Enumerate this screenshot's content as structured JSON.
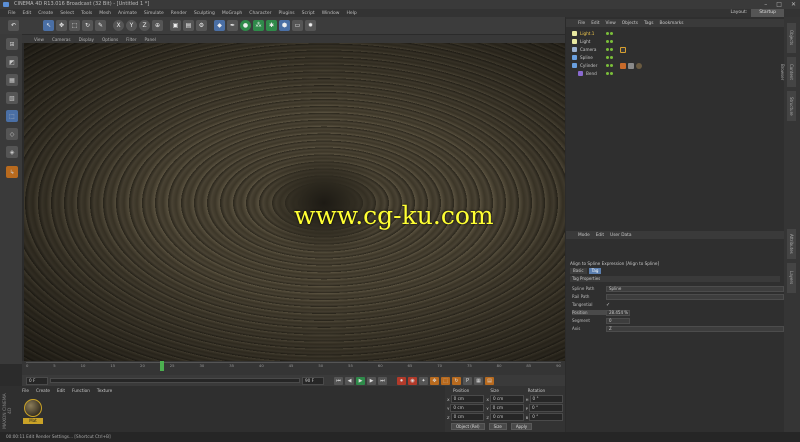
{
  "title": "CINEMA 4D R13.016 Broadcast (32 Bit) - [Untitled 1 *]",
  "window_buttons": [
    "–",
    "□",
    "✕"
  ],
  "menu": [
    "File",
    "Edit",
    "Create",
    "Select",
    "Tools",
    "Mesh",
    "Animate",
    "Simulate",
    "Render",
    "Sculpting",
    "MoGraph",
    "Character",
    "Plugins",
    "Script",
    "Window",
    "Help"
  ],
  "layout": {
    "label": "Layout:",
    "value": "Startup"
  },
  "toolbar_glyphs": {
    "undo": "↶",
    "x": "X",
    "y": "Y",
    "z": "Z"
  },
  "viewport": {
    "menu": [
      "View",
      "Cameras",
      "Display",
      "Options",
      "Filter",
      "Panel"
    ],
    "watermark": "www.cg-ku.com"
  },
  "timeline": {
    "ticks": [
      "0",
      "5",
      "10",
      "15",
      "20",
      "25",
      "30",
      "35",
      "40",
      "45",
      "50",
      "55",
      "60",
      "65",
      "70",
      "75",
      "80",
      "85",
      "90"
    ],
    "start_frame": "0 F",
    "end_frame": "90 F",
    "playhead_fraction": 0.25
  },
  "transport_glyphs": [
    "⏮",
    "◀",
    "▶",
    "▶",
    "⏭",
    "⏺"
  ],
  "material": {
    "menu": [
      "File",
      "Create",
      "Edit",
      "Function",
      "Texture"
    ],
    "maxon": "MAXON CINEMA 4D",
    "name": "Mat"
  },
  "coordinates": {
    "headers": [
      "Position",
      "Size",
      "Rotation"
    ],
    "rows": [
      {
        "axis": "X",
        "pos": "0 cm",
        "size_axis": "X",
        "size": "0 cm",
        "rot_axis": "H",
        "rot": "0 °"
      },
      {
        "axis": "Y",
        "pos": "0 cm",
        "size_axis": "Y",
        "size": "0 cm",
        "rot_axis": "P",
        "rot": "0 °"
      },
      {
        "axis": "Z",
        "pos": "0 cm",
        "size_axis": "Z",
        "size": "0 cm",
        "rot_axis": "B",
        "rot": "0 °"
      }
    ],
    "mode": "Object (Rel)",
    "size_mode": "Size",
    "apply": "Apply"
  },
  "statusbar": "00:00:11   Edit Render Settings... [Shortcut Ctrl+B]",
  "objects": {
    "menu": [
      "File",
      "Edit",
      "View",
      "Objects",
      "Tags",
      "Bookmarks"
    ],
    "items": [
      {
        "name": "Light.1",
        "color": "#e8e8a0"
      },
      {
        "name": "Light",
        "color": "#e8e8a0"
      },
      {
        "name": "Camera",
        "color": "#9ab0d0"
      },
      {
        "name": "Spline",
        "color": "#6aa0e0"
      },
      {
        "name": "Cylinder",
        "color": "#6aa0e0"
      },
      {
        "name": "Bend",
        "color": "#8a6ad0"
      }
    ]
  },
  "attributes": {
    "menu": [
      "Mode",
      "Edit",
      "User Data"
    ],
    "title": "Align to Spline Expression [Align to Spline]",
    "tabs": [
      "Basic",
      "Tag"
    ],
    "section": "Tag Properties",
    "rows": [
      {
        "label": "Spline Path",
        "value": "Spline"
      },
      {
        "label": "Rail Path",
        "value": ""
      },
      {
        "label": "Tangential",
        "value": "✓"
      },
      {
        "label": "Position",
        "value": "28.454 %"
      },
      {
        "label": "Segment",
        "value": "0"
      },
      {
        "label": "Axis",
        "value": "Z"
      }
    ]
  },
  "side_tabs": [
    "Objects",
    "Content Browser",
    "Structure",
    "Attributes",
    "Layers"
  ]
}
